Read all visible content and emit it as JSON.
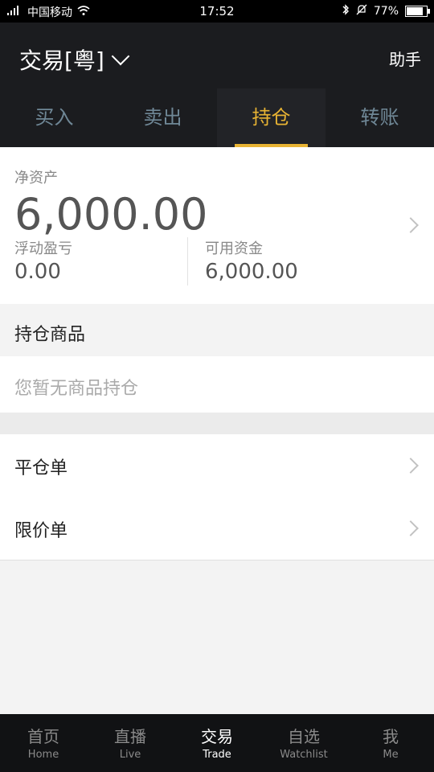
{
  "status": {
    "carrier": "中国移动",
    "time": "17:52",
    "battery": "77%"
  },
  "header": {
    "title": "交易[粤]",
    "helper": "助手"
  },
  "tabs": [
    {
      "label": "买入",
      "active": false
    },
    {
      "label": "卖出",
      "active": false
    },
    {
      "label": "持仓",
      "active": true
    },
    {
      "label": "转账",
      "active": false
    }
  ],
  "summary": {
    "net_assets_label": "净资产",
    "net_assets_value": "6,000.00",
    "floating_pl_label": "浮动盈亏",
    "floating_pl_value": "0.00",
    "available_funds_label": "可用资金",
    "available_funds_value": "6,000.00"
  },
  "positions": {
    "header": "持仓商品",
    "empty_text": "您暂无商品持仓"
  },
  "list": [
    {
      "label": "平仓单"
    },
    {
      "label": "限价单"
    }
  ],
  "nav": [
    {
      "cn": "首页",
      "en": "Home",
      "active": false
    },
    {
      "cn": "直播",
      "en": "Live",
      "active": false
    },
    {
      "cn": "交易",
      "en": "Trade",
      "active": true
    },
    {
      "cn": "自选",
      "en": "Watchlist",
      "active": false
    },
    {
      "cn": "我",
      "en": "Me",
      "active": false
    }
  ],
  "colors": {
    "accent": "#e8b333",
    "dark_bg": "#1b1c1f"
  },
  "icons": {
    "signal": "signal-icon",
    "wifi": "wifi-icon",
    "bluetooth": "bluetooth-icon",
    "bell_off": "bell-off-icon",
    "battery": "battery-icon"
  }
}
